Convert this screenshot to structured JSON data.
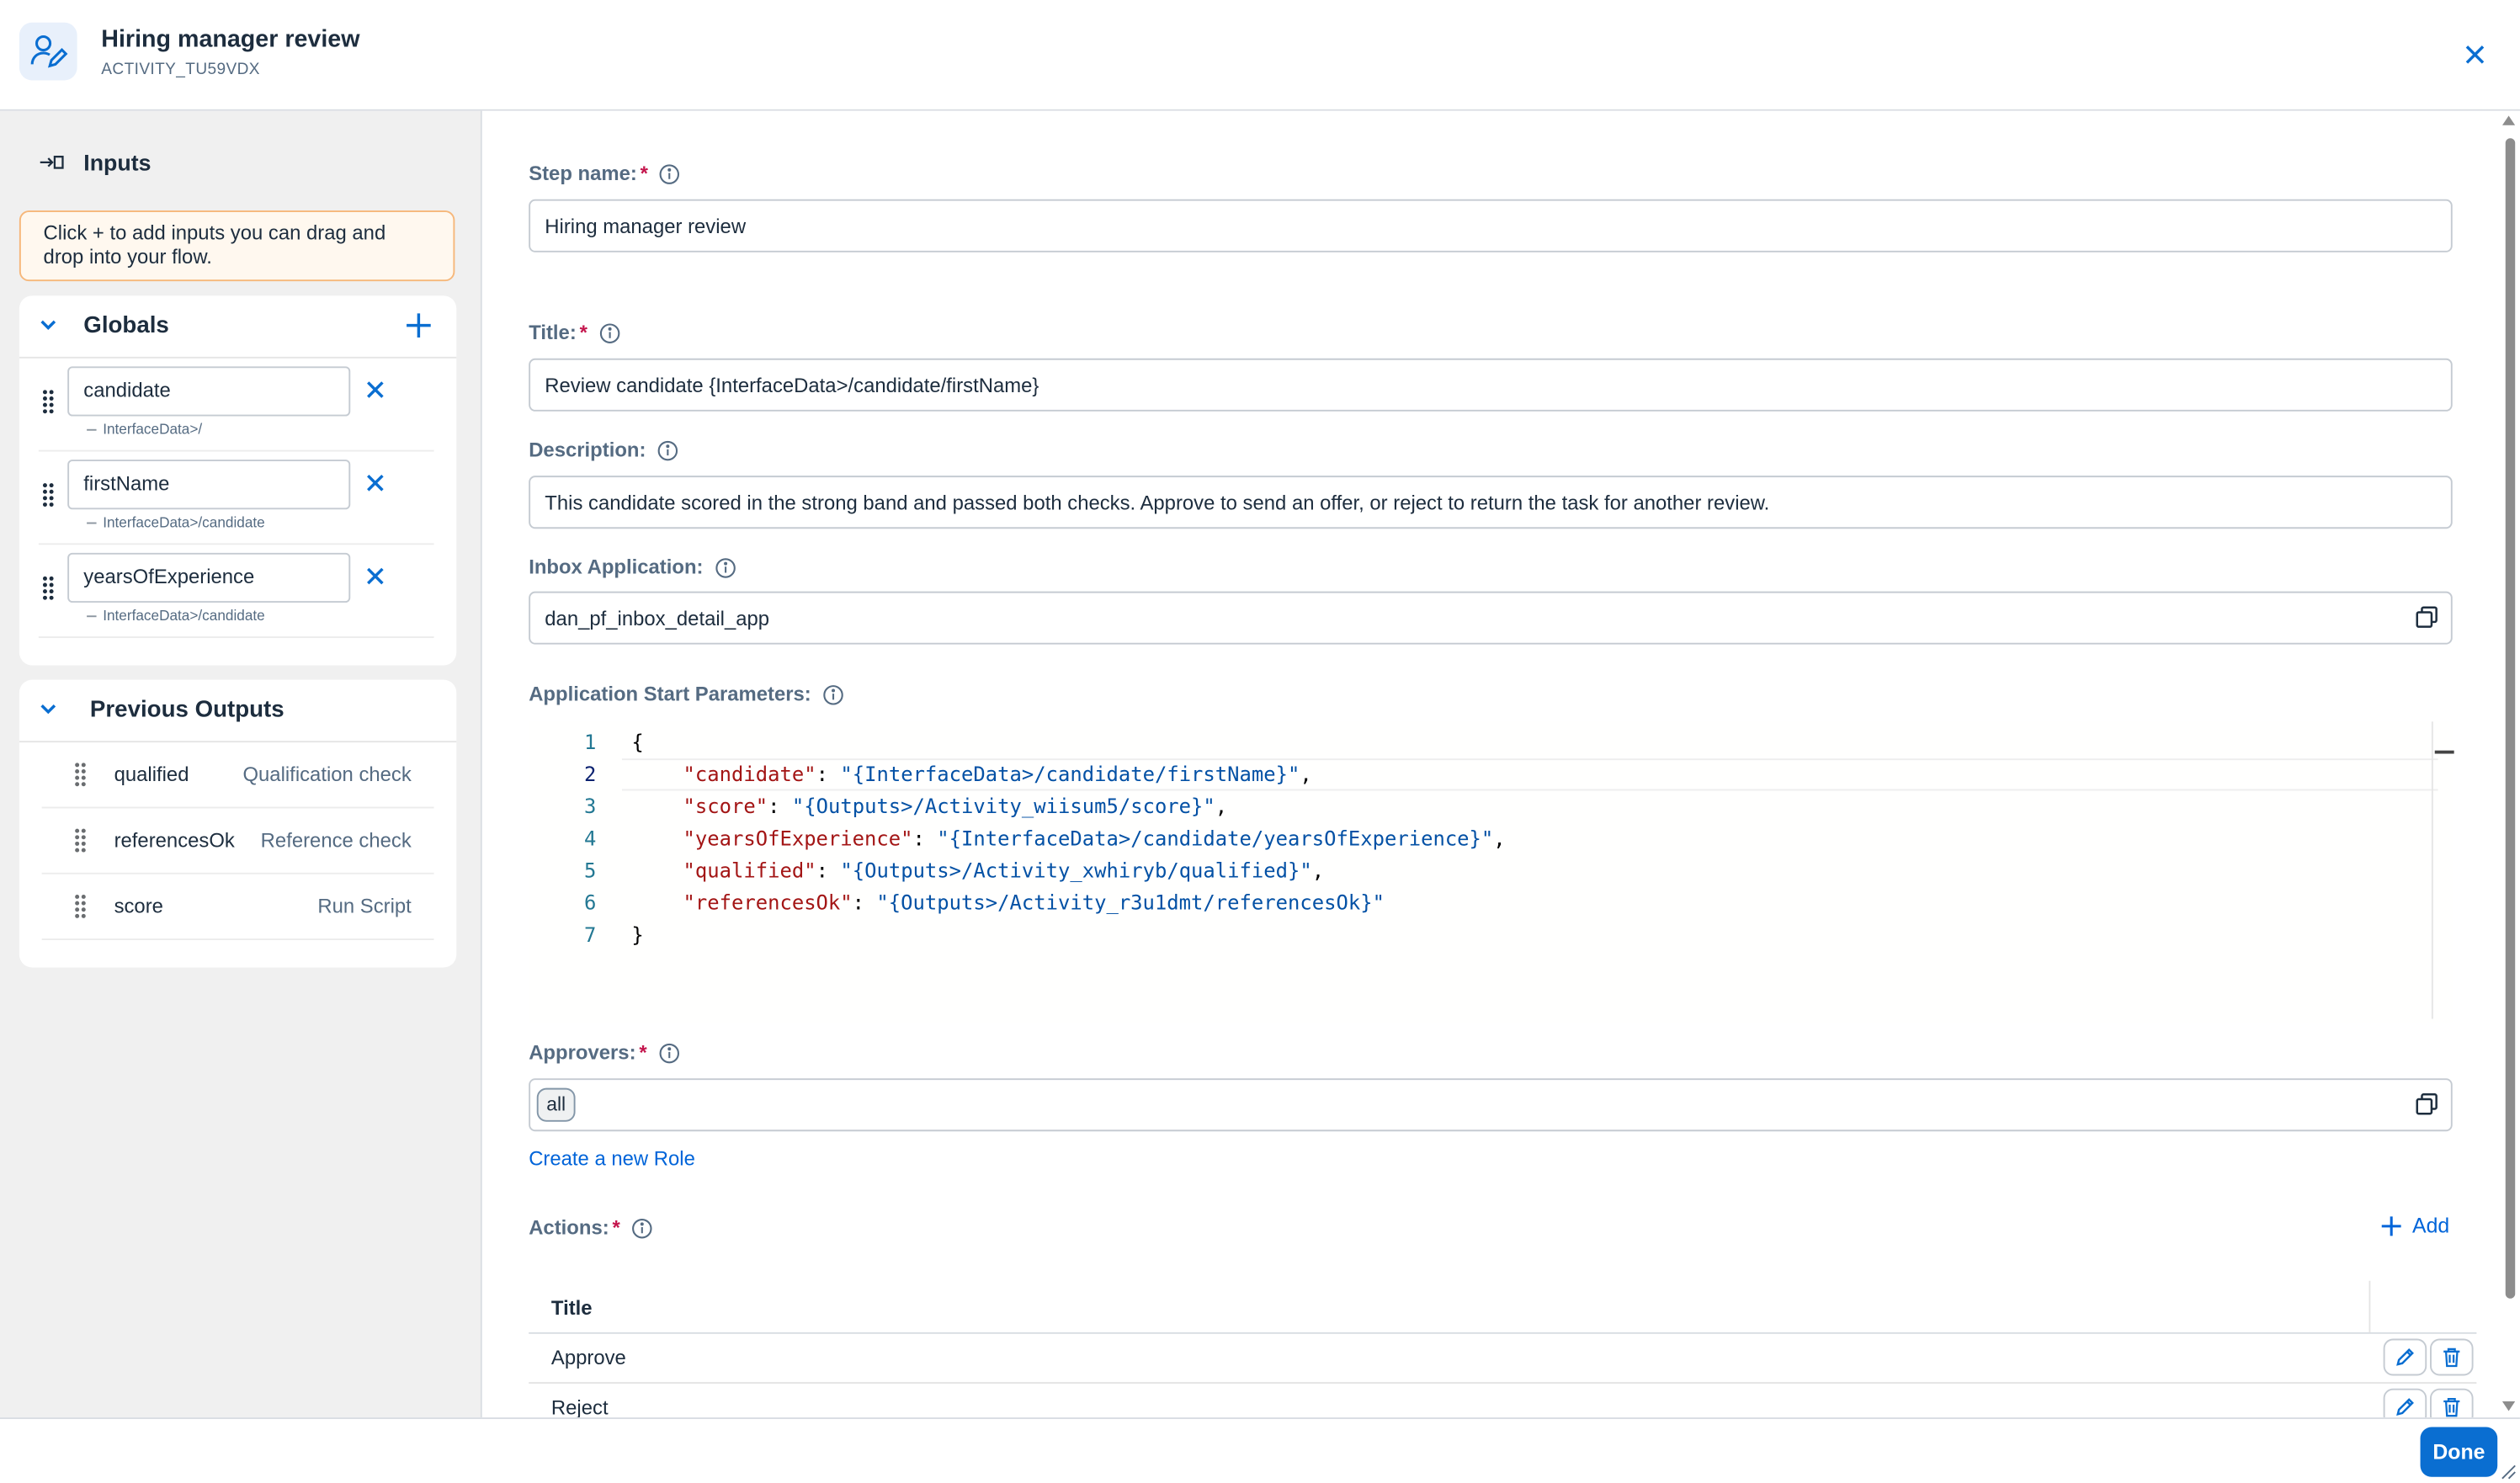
{
  "header": {
    "title": "Hiring manager review",
    "subtitle": "ACTIVITY_TU59VDX"
  },
  "sidebar": {
    "inputs_title": "Inputs",
    "hint": "Click + to add inputs you can drag and drop into your flow.",
    "globals": {
      "title": "Globals",
      "items": [
        {
          "name": "candidate",
          "path": "InterfaceData>/"
        },
        {
          "name": "firstName",
          "path": "InterfaceData>/candidate"
        },
        {
          "name": "yearsOfExperience",
          "path": "InterfaceData>/candidate"
        }
      ]
    },
    "previous_outputs": {
      "title": "Previous Outputs",
      "items": [
        {
          "name": "qualified",
          "source": "Qualification check"
        },
        {
          "name": "referencesOk",
          "source": "Reference check"
        },
        {
          "name": "score",
          "source": "Run Script"
        }
      ]
    }
  },
  "form": {
    "step_name": {
      "label": "Step name:",
      "required": "*",
      "value": "Hiring manager review"
    },
    "title": {
      "label": "Title:",
      "required": "*",
      "value": "Review candidate {InterfaceData>/candidate/firstName}"
    },
    "description": {
      "label": "Description:",
      "value": "This candidate scored in the strong band and passed both checks. Approve to send an offer, or reject to return the task for another review."
    },
    "inbox_application": {
      "label": "Inbox Application:",
      "value": "dan_pf_inbox_detail_app"
    },
    "start_params": {
      "label": "Application Start Parameters:",
      "line_numbers": [
        "1",
        "2",
        "3",
        "4",
        "5",
        "6",
        "7"
      ],
      "open_brace": "{",
      "close_brace": "}",
      "lines": [
        {
          "key": "\"candidate\"",
          "value": "\"{InterfaceData>/candidate/firstName}\"",
          "comma": ","
        },
        {
          "key": "\"score\"",
          "value": "\"{Outputs>/Activity_wiisum5/score}\"",
          "comma": ","
        },
        {
          "key": "\"yearsOfExperience\"",
          "value": "\"{InterfaceData>/candidate/yearsOfExperience}\"",
          "comma": ","
        },
        {
          "key": "\"qualified\"",
          "value": "\"{Outputs>/Activity_xwhiryb/qualified}\"",
          "comma": ","
        },
        {
          "key": "\"referencesOk\"",
          "value": "\"{Outputs>/Activity_r3u1dmt/referencesOk}\"",
          "comma": ""
        }
      ]
    },
    "approvers": {
      "label": "Approvers:",
      "required": "*",
      "chip": "all"
    },
    "create_role_link": "Create a new Role",
    "actions": {
      "label": "Actions:",
      "required": "*",
      "add_label": "Add",
      "column_title": "Title",
      "rows": [
        {
          "title": "Approve"
        },
        {
          "title": "Reject"
        }
      ]
    }
  },
  "footer": {
    "done_label": "Done"
  },
  "colors": {
    "accent": "#0a6ed1",
    "link": "#0064d9",
    "required": "#c4164d",
    "hint_border": "#f6b77a"
  }
}
